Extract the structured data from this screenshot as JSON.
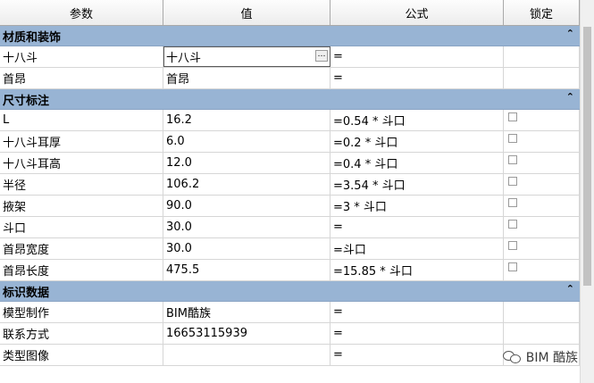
{
  "columns": {
    "param": "参数",
    "value": "值",
    "formula": "公式",
    "lock": "锁定"
  },
  "groups": [
    {
      "title": "材质和装饰",
      "collapse_glyph": "⌃",
      "rows": [
        {
          "param": "十八斗",
          "value": "十八斗",
          "formula": "=",
          "lock": false,
          "editing": true
        },
        {
          "param": "首昂",
          "value": "首昂",
          "formula": "=",
          "lock": false
        }
      ]
    },
    {
      "title": "尺寸标注",
      "collapse_glyph": "⌃",
      "rows": [
        {
          "param": "L",
          "value": "16.2",
          "formula": "=0.54 * 斗口",
          "lock": true
        },
        {
          "param": "十八斗耳厚",
          "value": "6.0",
          "formula": "=0.2 * 斗口",
          "lock": true
        },
        {
          "param": "十八斗耳高",
          "value": "12.0",
          "formula": "=0.4 * 斗口",
          "lock": true
        },
        {
          "param": "半径",
          "value": "106.2",
          "formula": "=3.54 * 斗口",
          "lock": true
        },
        {
          "param": "掖架",
          "value": "90.0",
          "formula": "=3 * 斗口",
          "lock": true
        },
        {
          "param": "斗口",
          "value": "30.0",
          "formula": "=",
          "lock": true
        },
        {
          "param": "首昂宽度",
          "value": "30.0",
          "formula": "=斗口",
          "lock": true
        },
        {
          "param": "首昂长度",
          "value": "475.5",
          "formula": "=15.85 * 斗口",
          "lock": true
        }
      ]
    },
    {
      "title": "标识数据",
      "collapse_glyph": "⌃",
      "rows": [
        {
          "param": "模型制作",
          "value": "BIM酷族",
          "formula": "=",
          "lock": false
        },
        {
          "param": "联系方式",
          "value": "16653115939",
          "formula": "=",
          "lock": false
        },
        {
          "param": "类型图像",
          "value": "",
          "formula": "=",
          "lock": false
        }
      ]
    }
  ],
  "edit_button_glyph": "…",
  "watermark": {
    "text": "BIM 酷族"
  }
}
